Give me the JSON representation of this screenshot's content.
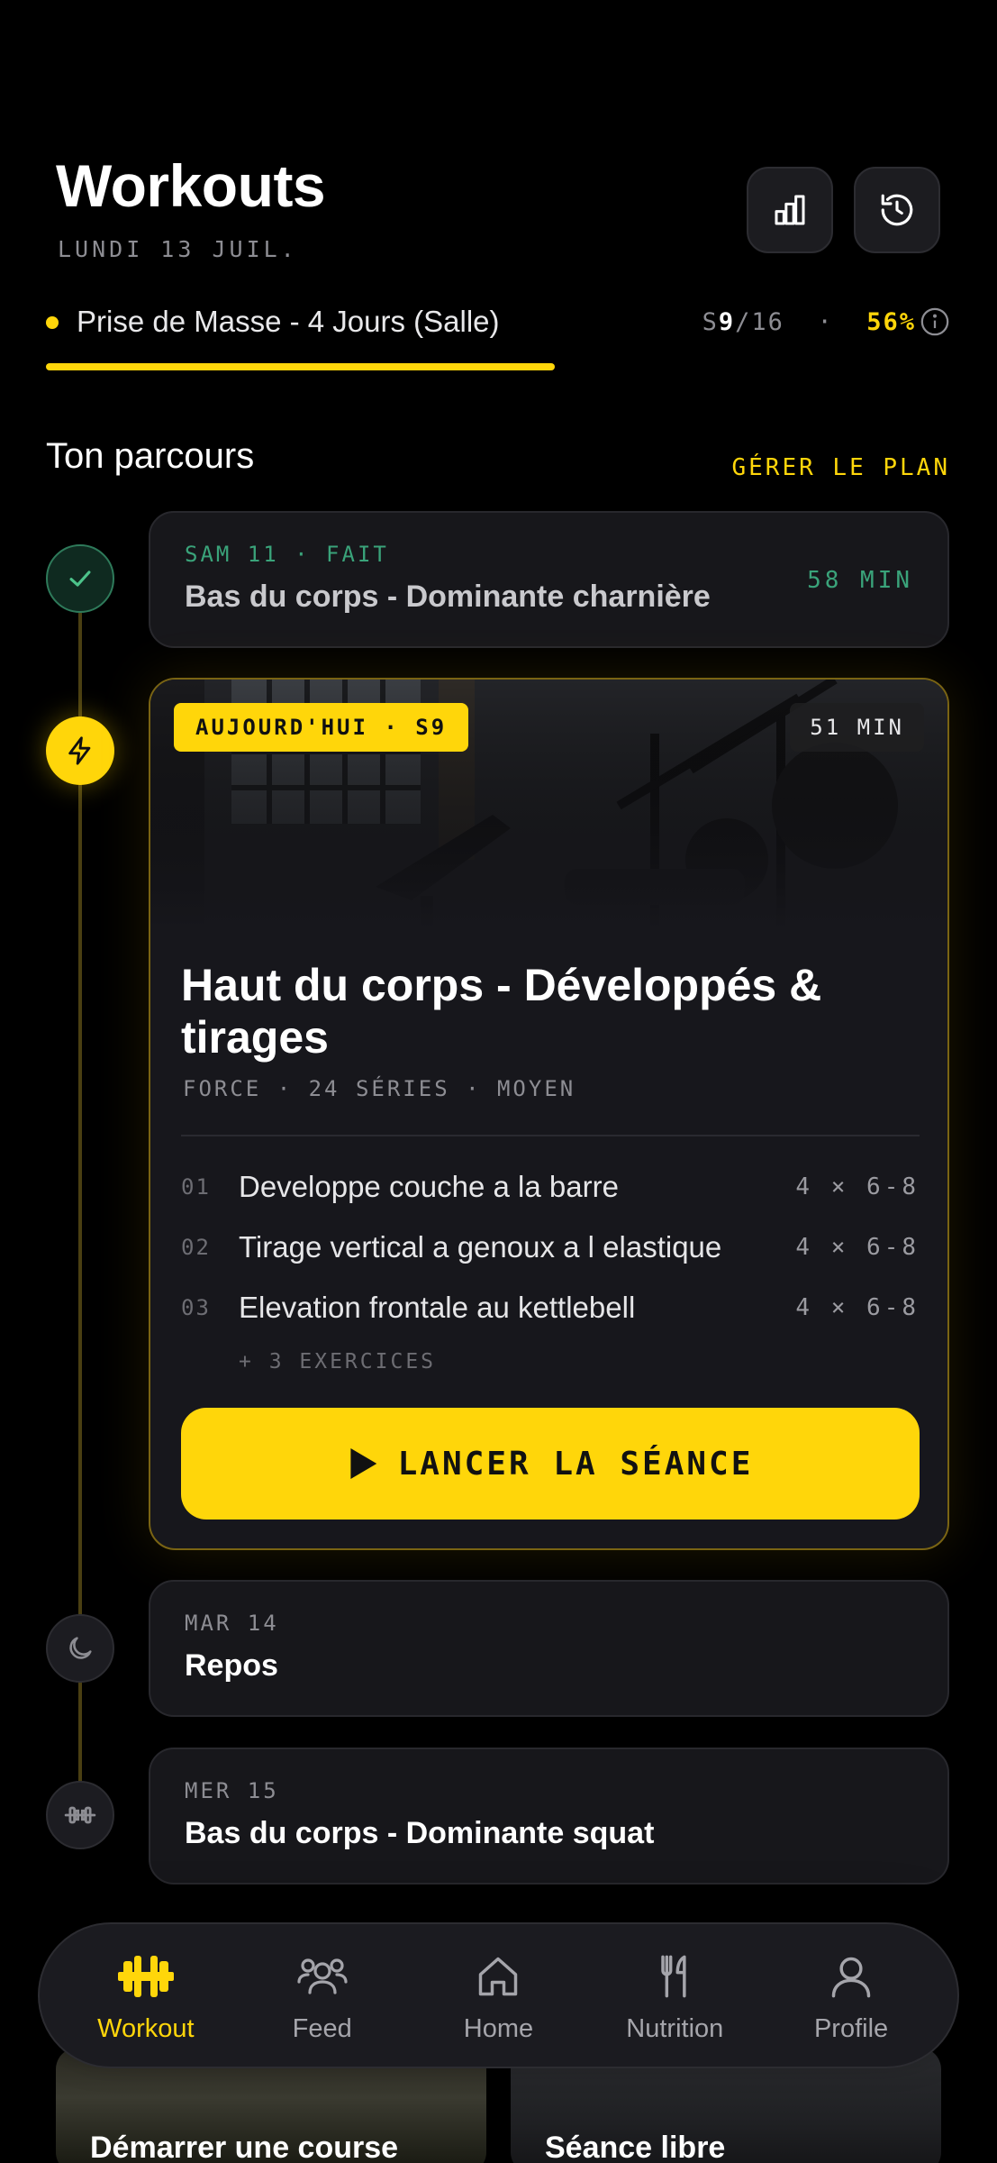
{
  "header": {
    "title": "Workouts",
    "date": "LUNDI 13 JUIL.",
    "stats_icon": "bar-chart-icon",
    "history_icon": "history-icon"
  },
  "plan": {
    "name": "Prise de Masse - 4 Jours (Salle)",
    "week_prefix": "S",
    "week_current": "9",
    "week_total": "/16",
    "separator": "·",
    "percent": "56%",
    "progress": 0.56,
    "accent": "#ffd60a"
  },
  "journey": {
    "title": "Ton parcours",
    "manage_label": "GÉRER LE PLAN"
  },
  "sessions": {
    "done": {
      "label": "SAM 11 · FAIT",
      "title": "Bas du corps - Dominante charnière",
      "duration": "58 MIN",
      "color": "#3aa37a"
    },
    "today": {
      "badge": "AUJOURD'HUI · S9",
      "duration": "51 MIN",
      "title": "Haut du corps - Développés & tirages",
      "meta": "FORCE · 24 SÉRIES · MOYEN",
      "exercises": [
        {
          "num": "01",
          "name": "Developpe couche a la barre",
          "sets": "4 × 6-8"
        },
        {
          "num": "02",
          "name": "Tirage vertical a genoux a l elastique",
          "sets": "4 × 6-8"
        },
        {
          "num": "03",
          "name": "Elevation frontale au kettlebell",
          "sets": "4 × 6-8"
        }
      ],
      "more": "+ 3 EXERCICES",
      "launch_label": "LANCER LA SÉANCE"
    },
    "rest": {
      "label": "MAR 14",
      "title": "Repos"
    },
    "next": {
      "label": "MER 15",
      "title": "Bas du corps - Dominante squat"
    }
  },
  "quick_actions": [
    {
      "title": "Démarrer une course"
    },
    {
      "title": "Séance libre"
    }
  ],
  "tabbar": {
    "items": [
      {
        "label": "Workout",
        "icon": "dumbbell-icon",
        "active": true
      },
      {
        "label": "Feed",
        "icon": "users-icon",
        "active": false
      },
      {
        "label": "Home",
        "icon": "home-icon",
        "active": false
      },
      {
        "label": "Nutrition",
        "icon": "fork-knife-icon",
        "active": false
      },
      {
        "label": "Profile",
        "icon": "user-icon",
        "active": false
      }
    ]
  }
}
